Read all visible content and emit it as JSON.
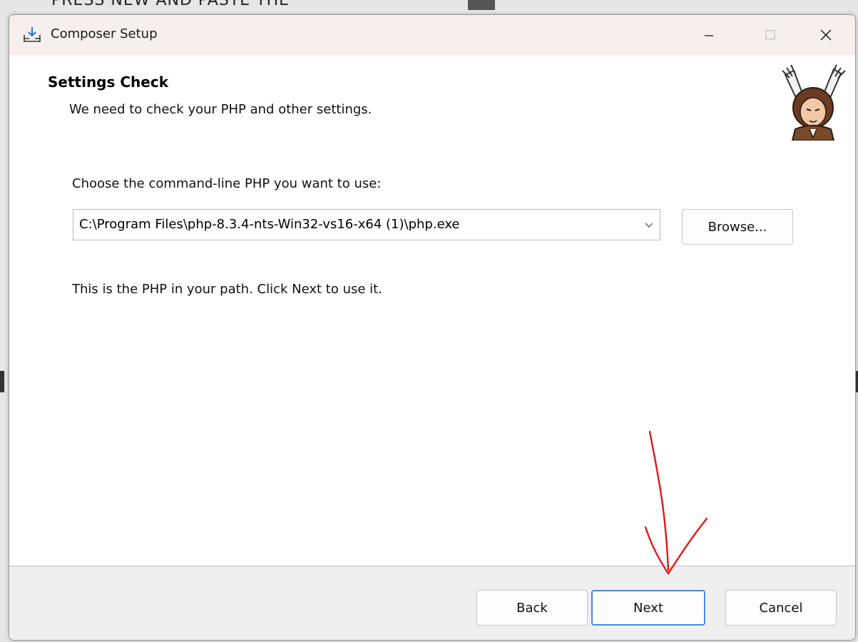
{
  "background": {
    "partial_text": "PRESS NEW AND PASTE THE"
  },
  "window": {
    "title": "Composer Setup",
    "icon": "download-tray-icon",
    "controls": {
      "minimize_icon": "minimize-icon",
      "maximize_icon": "maximize-icon",
      "close_icon": "close-icon"
    }
  },
  "header": {
    "title": "Settings Check",
    "subtitle": "We need to check your PHP and other settings.",
    "logo_icon": "composer-logo-icon"
  },
  "main": {
    "choose_label": "Choose the command-line PHP you want to use:",
    "php_select": {
      "value": "C:\\Program Files\\php-8.3.4-nts-Win32-vs16-x64 (1)\\php.exe"
    },
    "browse_label": "Browse...",
    "info_text": "This is the PHP in your path. Click Next to use it."
  },
  "footer": {
    "back_label": "Back",
    "next_label": "Next",
    "cancel_label": "Cancel"
  },
  "colors": {
    "titlebar_bg": "#f7efed",
    "accent_border": "#4a8ad8",
    "annotation_red": "#e01818"
  }
}
